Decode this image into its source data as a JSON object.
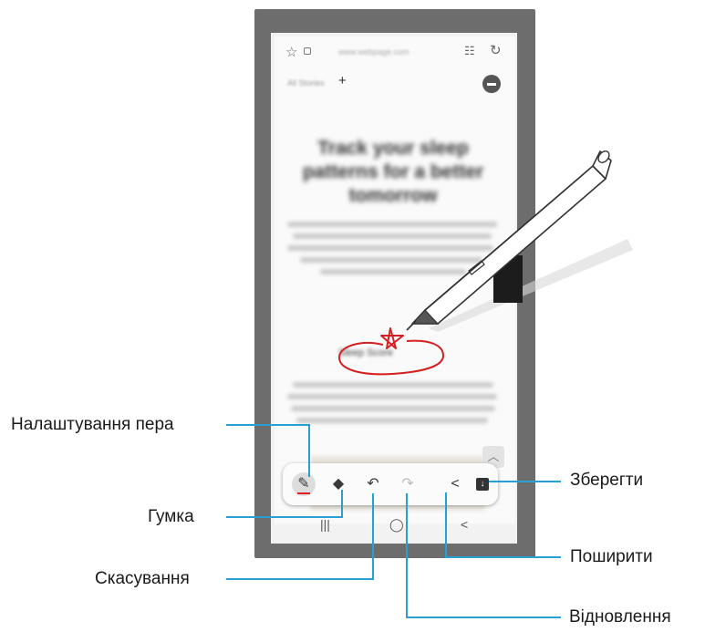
{
  "callouts": {
    "pen_settings": "Налаштування пера",
    "eraser": "Гумка",
    "undo": "Скасування",
    "redo": "Відновлення",
    "save": "Зберегти",
    "share": "Поширити"
  },
  "page": {
    "headline": "Track your sleep patterns for a better tomorrow",
    "handwritten_label": "Sleep Score"
  },
  "icons": {
    "pen": "pen-icon",
    "eraser": "eraser-icon",
    "undo": "undo-icon",
    "redo": "redo-icon",
    "share": "share-icon",
    "save": "download-icon"
  },
  "colors": {
    "callout_line": "#2a9fd6",
    "annotation": "#d42020"
  }
}
